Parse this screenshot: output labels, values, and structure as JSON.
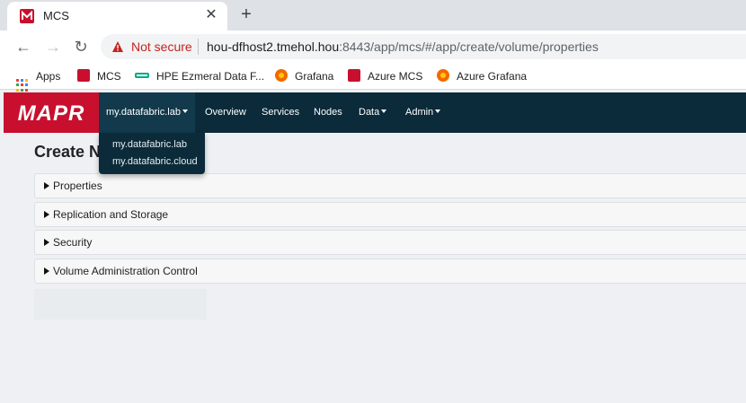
{
  "browser": {
    "tab_title": "MCS",
    "tab_close": "✕",
    "new_tab": "+",
    "security_label": "Not secure",
    "url_host": "hou-dfhost2.tmehol.hou",
    "url_path": ":8443/app/mcs/#/app/create/volume/properties",
    "nav": {
      "back": "←",
      "forward": "→",
      "reload": "↻"
    },
    "bookmarks": [
      {
        "label": "Apps",
        "icon": "apps-grid-icon"
      },
      {
        "label": "MCS",
        "icon": "mapr-icon"
      },
      {
        "label": "HPE Ezmeral Data F...",
        "icon": "hpe-icon"
      },
      {
        "label": "Grafana",
        "icon": "grafana-icon"
      },
      {
        "label": "Azure MCS",
        "icon": "mapr-icon"
      },
      {
        "label": "Azure Grafana",
        "icon": "grafana-icon"
      }
    ]
  },
  "app": {
    "logo": "MAPR",
    "nav": {
      "cluster": "my.datafabric.lab",
      "overview": "Overview",
      "services": "Services",
      "nodes": "Nodes",
      "data": "Data",
      "admin": "Admin"
    },
    "cluster_dropdown": [
      "my.datafabric.lab",
      "my.datafabric.cloud"
    ],
    "page_title": "Create N",
    "panels": [
      "Properties",
      "Replication and Storage",
      "Security",
      "Volume Administration Control"
    ]
  },
  "colors": {
    "brand_red": "#c8102e",
    "nav_dark": "#0b2b3a",
    "warning_red": "#c5221f"
  }
}
